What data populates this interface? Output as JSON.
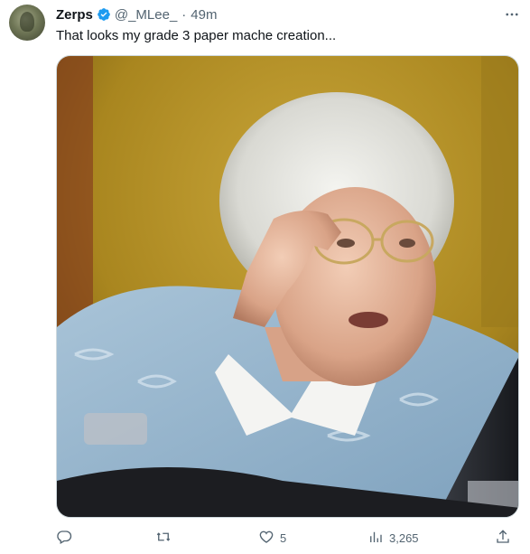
{
  "tweet": {
    "author": {
      "name": "Zerps",
      "handle": "@_MLee_",
      "separator": "·",
      "time": "49m",
      "verified": true
    },
    "text": "That looks my grade 3 paper mache creation...",
    "media": {
      "description_icon": "photo"
    },
    "actions": {
      "reply_count": "",
      "retweet_count": "",
      "like_count": "5",
      "views_count": "3,265"
    }
  },
  "icons": {
    "verified": "verified-badge-icon",
    "more": "more-horizontal-icon",
    "reply": "reply-icon",
    "retweet": "retweet-icon",
    "like": "heart-icon",
    "views": "views-bar-chart-icon",
    "share": "share-icon"
  },
  "colors": {
    "verified": "#1d9bf0",
    "secondary_text": "#536471",
    "primary_text": "#0f1419"
  }
}
